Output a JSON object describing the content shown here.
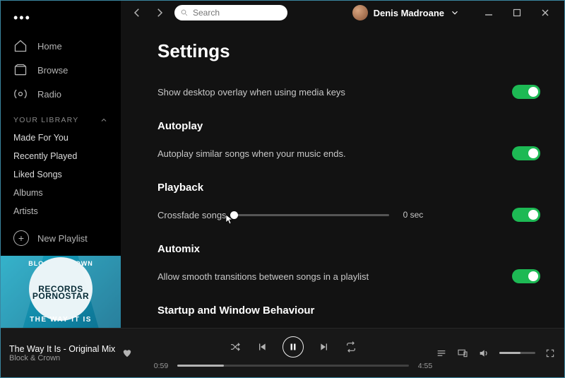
{
  "search": {
    "placeholder": "Search"
  },
  "user": {
    "name": "Denis Madroane"
  },
  "sidebar": {
    "nav": [
      {
        "label": "Home"
      },
      {
        "label": "Browse"
      },
      {
        "label": "Radio"
      }
    ],
    "library_header": "YOUR LIBRARY",
    "library": [
      {
        "label": "Made For You"
      },
      {
        "label": "Recently Played"
      },
      {
        "label": "Liked Songs"
      },
      {
        "label": "Albums"
      },
      {
        "label": "Artists"
      }
    ],
    "new_playlist": "New Playlist"
  },
  "cover": {
    "top_text": "BLOCK & CROWN",
    "brand_top": "PORNOSTAR",
    "brand_bottom": "RECORDS",
    "bottom_text": "THE WAY IT IS"
  },
  "settings": {
    "title": "Settings",
    "overlay_desc": "Show desktop overlay when using media keys",
    "autoplay_h": "Autoplay",
    "autoplay_desc": "Autoplay similar songs when your music ends.",
    "playback_h": "Playback",
    "crossfade_label": "Crossfade songs",
    "crossfade_value": "0 sec",
    "automix_h": "Automix",
    "automix_desc": "Allow smooth transitions between songs in a playlist",
    "startup_h": "Startup and Window Behaviour"
  },
  "player": {
    "title": "The Way It Is - Original Mix",
    "artist": "Block & Crown",
    "elapsed": "0:59",
    "total": "4:55"
  }
}
